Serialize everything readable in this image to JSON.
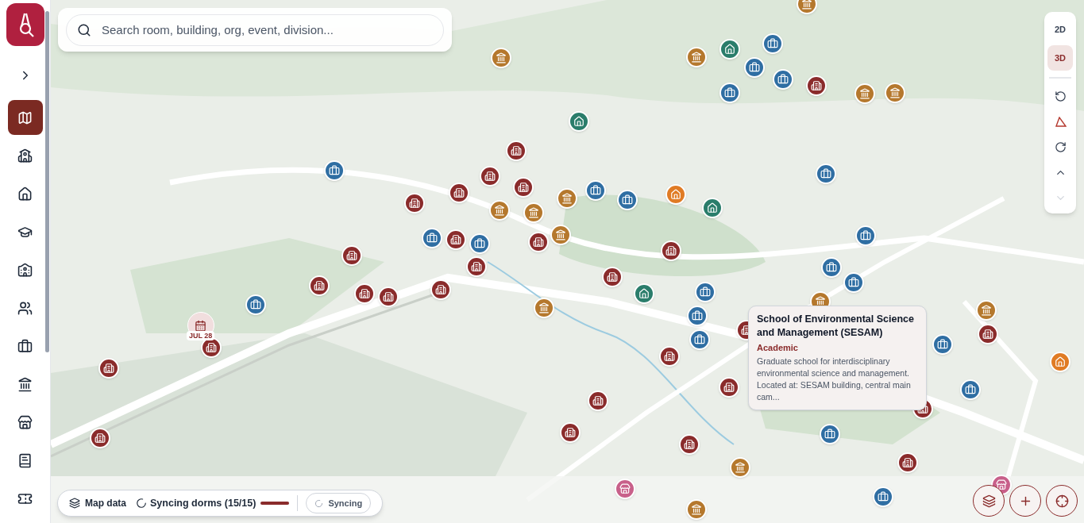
{
  "sidebar": {
    "items": [
      {
        "kind": "map",
        "selected": true
      },
      {
        "kind": "building",
        "selected": false
      },
      {
        "kind": "home",
        "selected": false
      },
      {
        "kind": "graduation",
        "selected": false
      },
      {
        "kind": "school",
        "selected": false
      },
      {
        "kind": "users",
        "selected": false
      },
      {
        "kind": "briefcase",
        "selected": false
      },
      {
        "kind": "landmark",
        "selected": false
      },
      {
        "kind": "store",
        "selected": false
      },
      {
        "kind": "book",
        "selected": false
      },
      {
        "kind": "ticket",
        "selected": false
      }
    ]
  },
  "search": {
    "placeholder": "Search room, building, org, event, division..."
  },
  "view_toggle": [
    {
      "label": "2D",
      "selected": false
    },
    {
      "label": "3D",
      "selected": true
    }
  ],
  "map_controls": [
    {
      "kind": "rotate-left",
      "disabled": false
    },
    {
      "kind": "compass",
      "disabled": false
    },
    {
      "kind": "rotate-right",
      "disabled": false
    },
    {
      "kind": "tilt-up",
      "disabled": false
    },
    {
      "kind": "tilt-down",
      "disabled": true
    }
  ],
  "event_pin": {
    "date": "JUL 28"
  },
  "popup": {
    "title": "School of Environmental Science and Management (SESAM)",
    "category": "Academic",
    "description": "Graduate school for interdisciplinary environmental science and management. Located at: SESAM building, central main cam..."
  },
  "status_bar": {
    "map_data": "Map data",
    "sync_status": "Syncing dorms (15/15)",
    "level": 1,
    "sync_button": "Syncing"
  }
}
